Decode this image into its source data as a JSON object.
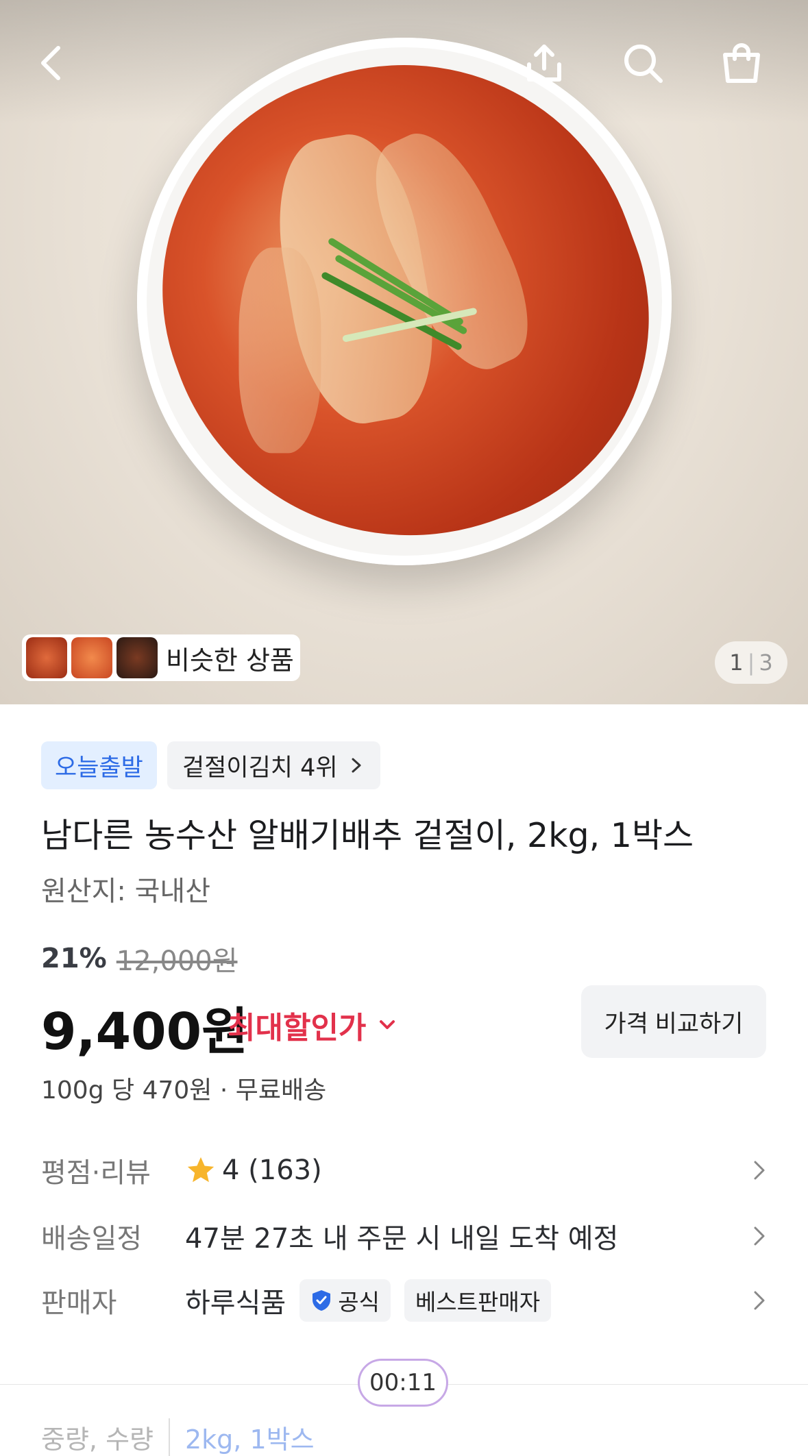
{
  "hero": {
    "similar_label": "비슷한 상품",
    "page_current": "1",
    "page_total": "3",
    "icons": [
      "back-arrow-icon",
      "share-icon",
      "search-icon",
      "shopping-bag-icon"
    ]
  },
  "badges": {
    "today": "오늘출발",
    "rank": "겉절이김치 4위"
  },
  "product": {
    "title": "남다른 농수산 알배기배추 겉절이, 2kg, 1박스",
    "origin": "원산지: 국내산"
  },
  "price": {
    "discount": "21%",
    "original": "12,000원",
    "current": "9,400원",
    "max_discount_label": "최대할인가",
    "compare_button": "가격 비교하기",
    "unit_info": "100g 당 470원 · 무료배송"
  },
  "info": {
    "rating_label": "평점·리뷰",
    "rating_value": "4 (163)",
    "delivery_label": "배송일정",
    "delivery_value": "47분 27초 내 주문 시 내일 도착 예정",
    "seller_label": "판매자",
    "seller_name": "하루식품",
    "official_tag": "공식",
    "best_tag": "베스트판매자"
  },
  "timer": "00:11",
  "options": {
    "label": "중량, 수량",
    "value": "2kg, 1박스"
  },
  "colors": {
    "accent_blue": "#2d6be6",
    "discount_red": "#e2314b",
    "star": "#f7b52c"
  }
}
